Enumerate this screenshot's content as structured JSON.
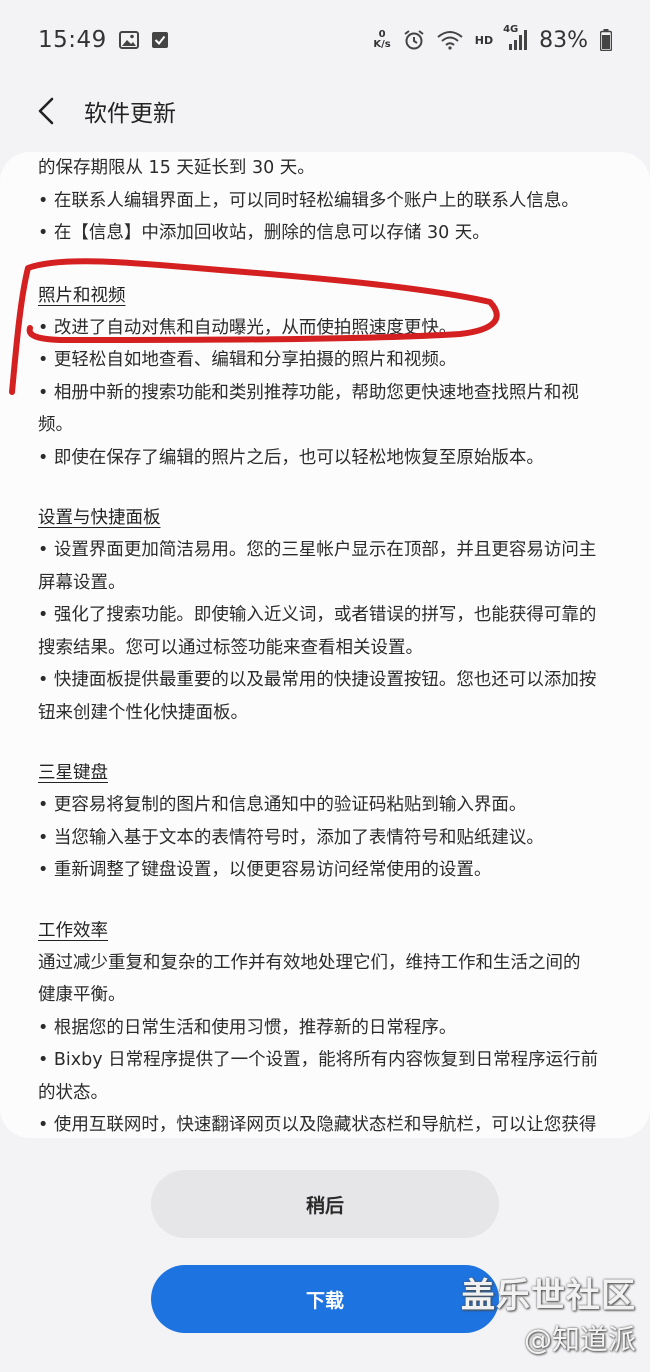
{
  "status_bar": {
    "time": "15:49",
    "net_speed_top": "0",
    "net_speed_unit": "K/s",
    "hd_label": "HD",
    "network_label": "4G",
    "battery": "83%"
  },
  "app_bar": {
    "title": "软件更新"
  },
  "content": {
    "intro_lines": [
      "的保存期限从 15 天延长到 30 天。",
      "• 在联系人编辑界面上，可以同时轻松编辑多个账户上的联系人信息。",
      "• 在【信息】中添加回收站，删除的信息可以存储 30 天。"
    ],
    "sections": [
      {
        "title": "照片和视频",
        "lines": [
          "• 改进了自动对焦和自动曝光，从而使拍照速度更快。",
          "• 更轻松自如地查看、编辑和分享拍摄的照片和视频。",
          "• 相册中新的搜索功能和类别推荐功能，帮助您更快速地查找照片和视",
          "频。",
          "• 即使在保存了编辑的照片之后，也可以轻松地恢复至原始版本。"
        ]
      },
      {
        "title": "设置与快捷面板",
        "lines": [
          "• 设置界面更加简洁易用。您的三星帐户显示在顶部，并且更容易访问主",
          "屏幕设置。",
          "• 强化了搜索功能。即使输入近义词，或者错误的拼写，也能获得可靠的",
          "搜索结果。您可以通过标签功能来查看相关设置。",
          "• 快捷面板提供最重要的以及最常用的快捷设置按钮。您也还可以添加按",
          "钮来创建个性化快捷面板。"
        ]
      },
      {
        "title": "三星键盘",
        "lines": [
          "• 更容易将复制的图片和信息通知中的验证码粘贴到输入界面。",
          "• 当您输入基于文本的表情符号时，添加了表情符号和贴纸建议。",
          "• 重新调整了键盘设置，以便更容易访问经常使用的设置。"
        ]
      },
      {
        "title": "工作效率",
        "lines": [
          "通过减少重复和复杂的工作并有效地处理它们，维持工作和生活之间的",
          "健康平衡。",
          "• 根据您的日常生活和使用习惯，推荐新的日常程序。",
          "• Bixby 日常程序提供了一个设置，能将所有内容恢复到日常程序运行前",
          "的状态。",
          "• 使用互联网时，快速翻译网页以及隐藏状态栏和导航栏，可以让您获得"
        ]
      }
    ]
  },
  "buttons": {
    "later": "稍后",
    "download": "下载"
  },
  "watermark": {
    "line1": "盖乐世社区",
    "line2": "@知道派"
  },
  "colors": {
    "primary": "#1d73e0",
    "annotation": "#d42020",
    "background": "#f3f3f5"
  }
}
